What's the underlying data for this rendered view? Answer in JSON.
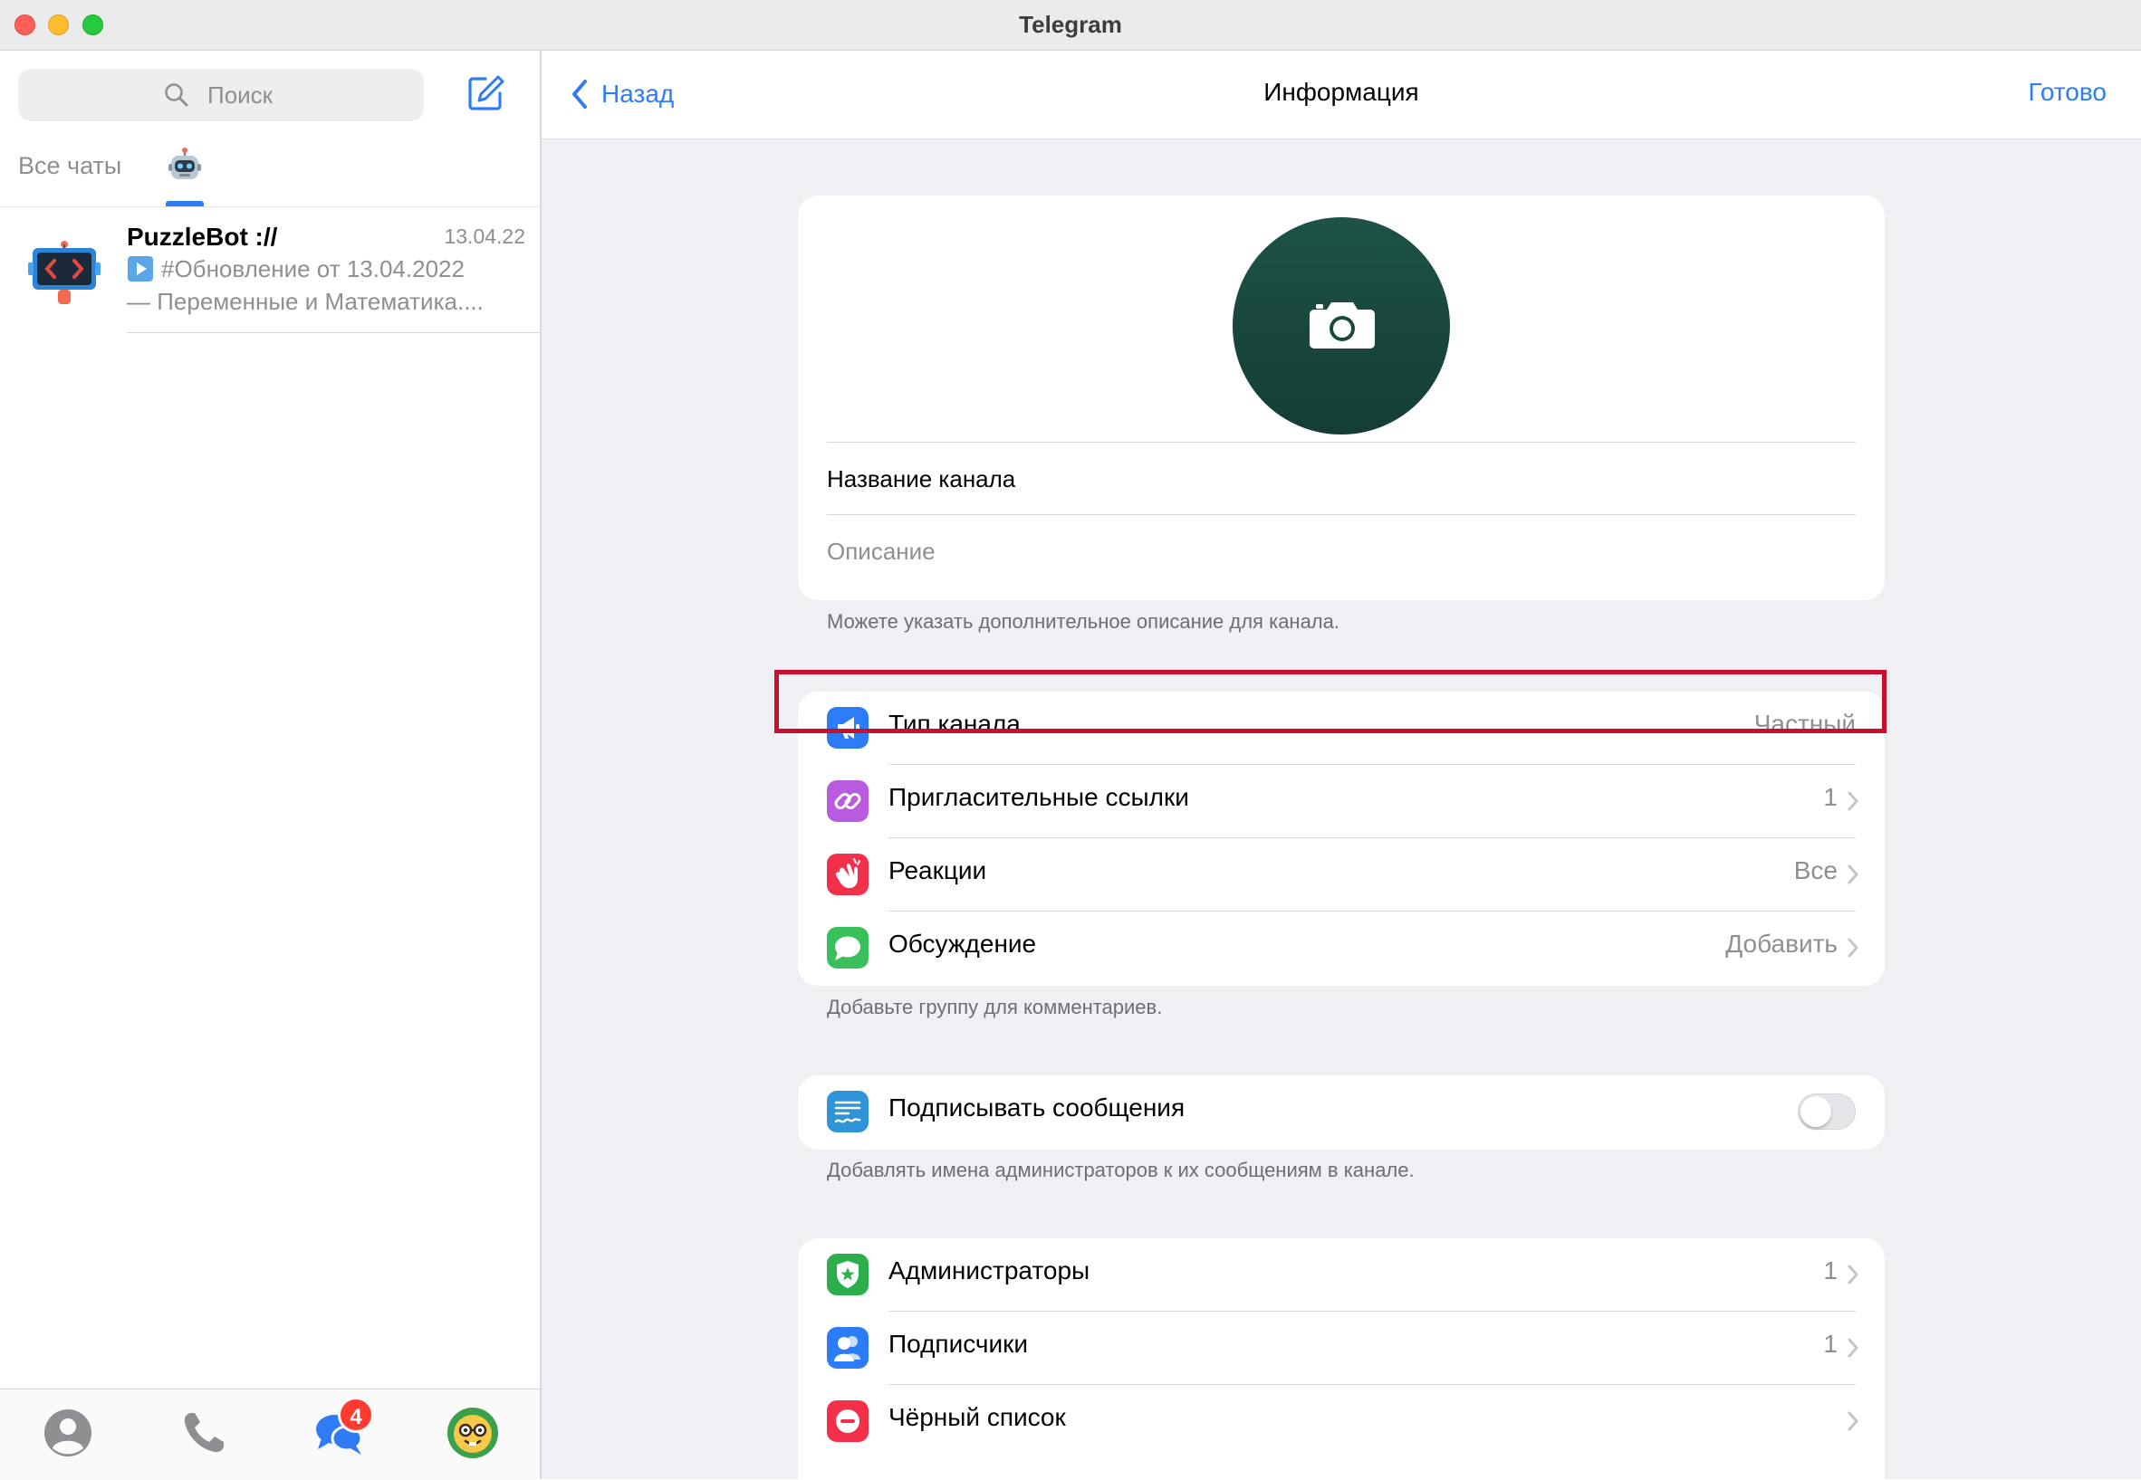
{
  "window": {
    "title": "Telegram"
  },
  "sidebar": {
    "search_placeholder": "Поиск",
    "tabs": [
      {
        "label": "Все чаты"
      },
      {
        "label": "",
        "icon": "robot-emoji-icon"
      }
    ],
    "chats": [
      {
        "name": "PuzzleBot ://",
        "date": "13.04.22",
        "line1": "#Обновление от 13.04.2022",
        "line2": "— Переменные и Математика...."
      }
    ],
    "bottom_nav": {
      "items": [
        "contacts-icon",
        "calls-icon",
        "chats-icon",
        "settings-icon"
      ],
      "chats_badge": "4"
    }
  },
  "navbar": {
    "back_label": "Назад",
    "title": "Информация",
    "done_label": "Готово"
  },
  "profile": {
    "name_value": "Название канала",
    "description_placeholder": "Описание",
    "description_hint": "Можете указать дополнительное описание для канала."
  },
  "settings": {
    "rows": [
      {
        "label": "Тип канала",
        "value": "Частный",
        "icon": "megaphone-icon",
        "color": "#2b7cf6"
      },
      {
        "label": "Пригласительные ссылки",
        "value": "1",
        "icon": "link-icon",
        "color": "#b85be0"
      },
      {
        "label": "Реакции",
        "value": "Все",
        "icon": "clap-icon",
        "color": "#f2304a"
      },
      {
        "label": "Обсуждение",
        "value": "Добавить",
        "icon": "speech-bubble-icon",
        "color": "#3ac05a"
      }
    ],
    "footnote": "Добавьте группу для комментариев."
  },
  "signing": {
    "label": "Подписывать сообщения",
    "enabled": false,
    "icon": "signature-icon",
    "color": "#2f93d8",
    "footnote": "Добавлять имена администраторов к их сообщениям в канале."
  },
  "admins": {
    "rows": [
      {
        "label": "Администраторы",
        "value": "1",
        "icon": "shield-star-icon",
        "color": "#2cae4d"
      },
      {
        "label": "Подписчики",
        "value": "1",
        "icon": "people-icon",
        "color": "#2b7cf6"
      },
      {
        "label": "Чёрный список",
        "value": "",
        "icon": "minus-circle-icon",
        "color": "#f2304a"
      }
    ]
  },
  "colors": {
    "accent": "#2f7bf6",
    "highlight_border": "#c8102e",
    "avatar_bg": "#1a4a3f"
  }
}
